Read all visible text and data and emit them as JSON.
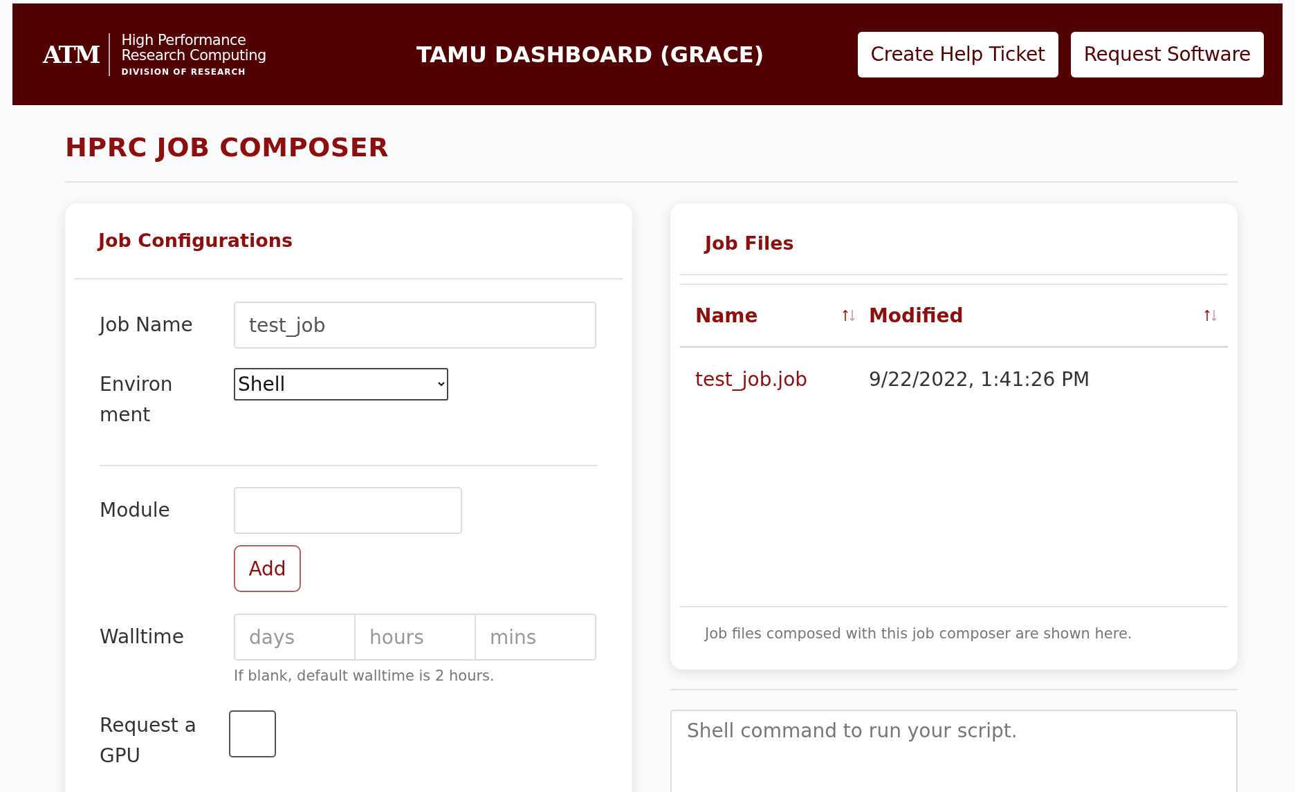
{
  "header": {
    "logo_mark": "ATM",
    "org_lines": [
      "High Performance",
      "Research Computing"
    ],
    "org_division": "DIVISION OF RESEARCH",
    "title": "TAMU DASHBOARD (GRACE)",
    "buttons": [
      "Create Help Ticket",
      "Request Software"
    ]
  },
  "page_title": "HPRC JOB COMPOSER",
  "job_configurations": {
    "title": "Job Configurations",
    "job_name": {
      "label": "Job Name",
      "value": "test_job"
    },
    "environment": {
      "label": "Environment",
      "value": "Shell"
    },
    "module": {
      "label": "Module",
      "button": "Add"
    },
    "walltime": {
      "label": "Walltime",
      "placeholders": [
        "days",
        "hours",
        "mins"
      ],
      "help": "If blank, default walltime is 2 hours."
    },
    "gpu": {
      "label": "Request a GPU",
      "checked": false
    }
  },
  "job_files": {
    "title": "Job Files",
    "columns": [
      "Name",
      "Modified"
    ],
    "rows": [
      {
        "name": "test_job.job",
        "modified": "9/22/2022, 1:41:26 PM"
      }
    ],
    "footer": "Job files composed with this job composer are shown here."
  },
  "command": {
    "placeholder": "Shell command to run your script."
  }
}
